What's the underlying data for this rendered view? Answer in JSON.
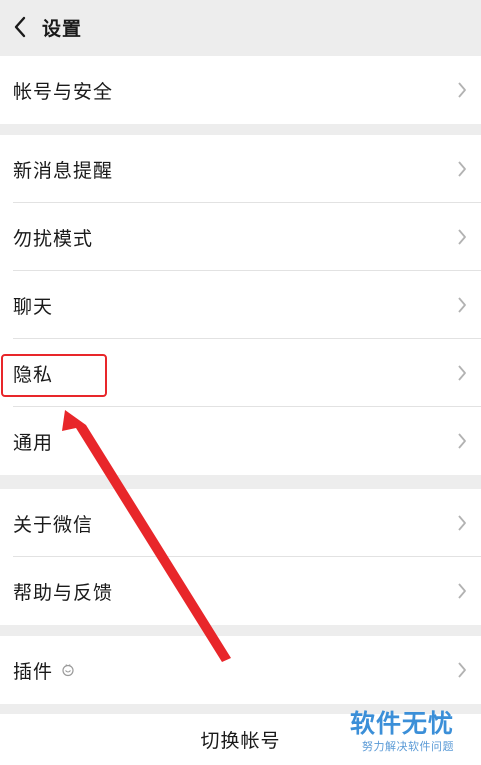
{
  "header": {
    "title": "设置"
  },
  "groups": [
    {
      "items": [
        {
          "label": "帐号与安全"
        }
      ]
    },
    {
      "items": [
        {
          "label": "新消息提醒"
        },
        {
          "label": "勿扰模式"
        },
        {
          "label": "聊天"
        },
        {
          "label": "隐私"
        },
        {
          "label": "通用"
        }
      ]
    },
    {
      "items": [
        {
          "label": "关于微信"
        },
        {
          "label": "帮助与反馈"
        }
      ]
    },
    {
      "items": [
        {
          "label": "插件"
        }
      ]
    }
  ],
  "switch_account": {
    "label": "切换帐号"
  },
  "annotation": {
    "color": "#e8262a",
    "highlighted_item": "隐私"
  },
  "watermark": {
    "brand": "软件无忧",
    "slogan": "努力解决软件问题"
  },
  "icons": {
    "back": "chevron-left-icon",
    "row_arrow": "chevron-right-icon",
    "plugin_badge": "plugin-badge-icon"
  }
}
